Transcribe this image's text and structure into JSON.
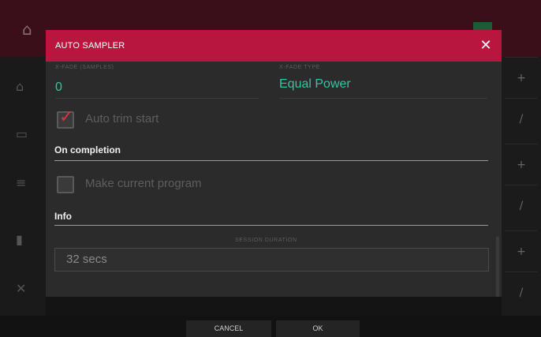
{
  "modal": {
    "title": "AUTO SAMPLER",
    "xfade_samples_label": "X-FADE (SAMPLES)",
    "xfade_samples_value": "0",
    "xfade_type_label": "X-FADE TYPE",
    "xfade_type_value": "Equal Power",
    "auto_trim_label": "Auto trim start",
    "auto_trim_checked": true,
    "on_completion_title": "On completion",
    "make_current_label": "Make current program",
    "make_current_checked": false,
    "info_title": "Info",
    "session_duration_label": "SESSION DURATION",
    "session_duration_value": "32 secs"
  },
  "footer": {
    "cancel_label": "CANCEL",
    "ok_label": "OK"
  },
  "colors": {
    "header": "#b8163e",
    "accent_teal": "#35c4a0",
    "check_red": "#e03040"
  }
}
